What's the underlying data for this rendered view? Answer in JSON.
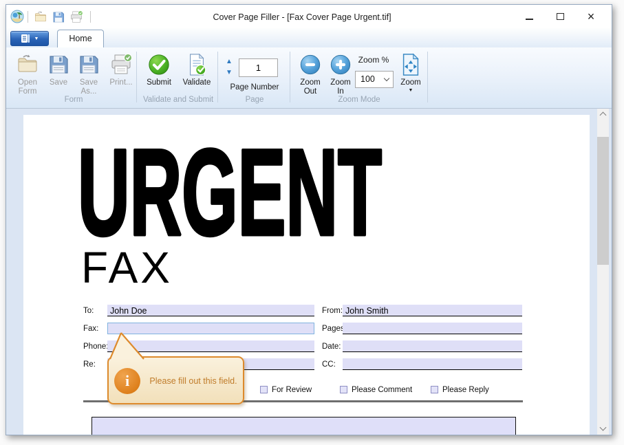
{
  "titlebar": {
    "title": "Cover Page Filler - [Fax Cover Page Urgent.tif]"
  },
  "icons": {
    "menu_caret": "▼",
    "page_up": "▲",
    "page_down": "▼",
    "zoom_caret": "▼",
    "close": "×",
    "info": "i"
  },
  "tabs": {
    "home": "Home"
  },
  "ribbon": {
    "form_group": {
      "label": "Form",
      "open_form": "Open\nForm",
      "save": "Save",
      "save_as": "Save\nAs...",
      "print": "Print..."
    },
    "validate_group": {
      "label": "Validate and Submit",
      "submit": "Submit",
      "validate": "Validate"
    },
    "page_group": {
      "label": "Page",
      "field_label": "Page Number",
      "value": "1"
    },
    "zoom_group": {
      "label": "Zoom Mode",
      "zoom_out": "Zoom\nOut",
      "zoom_in": "Zoom\nIn",
      "percent_label": "Zoom %",
      "percent_value": "100",
      "zoom_button": "Zoom"
    }
  },
  "document": {
    "heading": "URGENT",
    "subheading": "FAX",
    "fields": {
      "to": {
        "label": "To:",
        "value": "John Doe"
      },
      "from": {
        "label": "From:",
        "value": "John Smith"
      },
      "fax": {
        "label": "Fax:",
        "value": ""
      },
      "pages": {
        "label": "Pages:",
        "value": ""
      },
      "phone": {
        "label": "Phone:",
        "value": ""
      },
      "date": {
        "label": "Date:",
        "value": ""
      },
      "re": {
        "label": "Re:",
        "value": ""
      },
      "cc": {
        "label": "CC:",
        "value": ""
      }
    },
    "checkboxes": [
      {
        "label": "For Review",
        "checked": false
      },
      {
        "label": "Please Comment",
        "checked": false
      },
      {
        "label": "Please Reply",
        "checked": false
      }
    ],
    "tooltip": {
      "text": "Please fill out this field."
    }
  },
  "colors": {
    "accent_blue": "#3b8ac4",
    "field_fill": "#dfdff7",
    "tooltip_border": "#dd8a2c",
    "tooltip_text": "#c07c2a",
    "submit_green": "#4db327"
  }
}
